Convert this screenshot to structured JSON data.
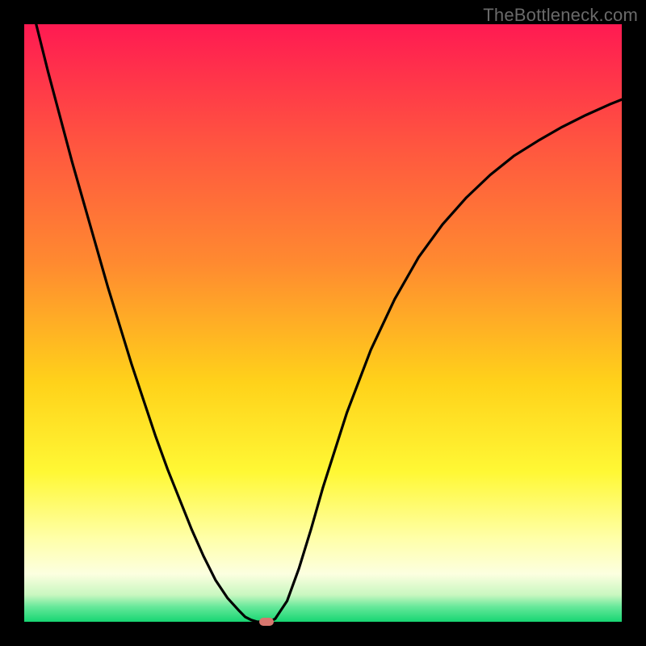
{
  "branding": {
    "watermark": "TheBottleneck.com"
  },
  "chart_data": {
    "type": "line",
    "title": "",
    "xlabel": "",
    "ylabel": "",
    "xlim": [
      0,
      1
    ],
    "ylim": [
      0,
      1
    ],
    "x": [
      0.0,
      0.02,
      0.04,
      0.06,
      0.08,
      0.1,
      0.12,
      0.14,
      0.16,
      0.18,
      0.2,
      0.22,
      0.24,
      0.26,
      0.28,
      0.3,
      0.32,
      0.34,
      0.36,
      0.37,
      0.38,
      0.39,
      0.4,
      0.41,
      0.42,
      0.44,
      0.46,
      0.48,
      0.5,
      0.54,
      0.58,
      0.62,
      0.66,
      0.7,
      0.74,
      0.78,
      0.82,
      0.86,
      0.9,
      0.94,
      0.98,
      1.0
    ],
    "series": [
      {
        "name": "bottleneck-curve",
        "values": [
          null,
          1.0,
          0.92,
          0.845,
          0.77,
          0.7,
          0.63,
          0.56,
          0.495,
          0.43,
          0.37,
          0.31,
          0.255,
          0.205,
          0.155,
          0.11,
          0.07,
          0.04,
          0.018,
          0.008,
          0.003,
          0.0,
          0.0,
          0.0,
          0.005,
          0.035,
          0.09,
          0.155,
          0.225,
          0.35,
          0.455,
          0.54,
          0.61,
          0.665,
          0.71,
          0.748,
          0.78,
          0.805,
          0.828,
          0.848,
          0.866,
          0.874
        ]
      }
    ],
    "minimum_marker": {
      "x": 0.405,
      "y": 0.0
    },
    "gradient_stops": [
      {
        "offset": 0.0,
        "color": "#ff1a52"
      },
      {
        "offset": 0.2,
        "color": "#ff5540"
      },
      {
        "offset": 0.4,
        "color": "#ff8a30"
      },
      {
        "offset": 0.6,
        "color": "#ffd21a"
      },
      {
        "offset": 0.75,
        "color": "#fff835"
      },
      {
        "offset": 0.86,
        "color": "#ffffa8"
      },
      {
        "offset": 0.92,
        "color": "#fcffe0"
      },
      {
        "offset": 0.955,
        "color": "#c9f7c0"
      },
      {
        "offset": 0.975,
        "color": "#66e89a"
      },
      {
        "offset": 1.0,
        "color": "#17d672"
      }
    ]
  }
}
